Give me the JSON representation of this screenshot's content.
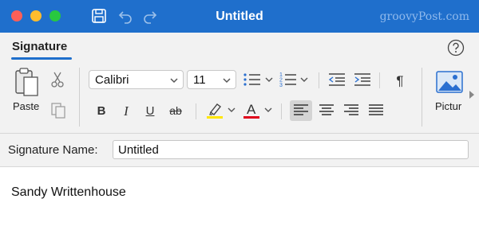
{
  "window": {
    "title": "Untitled",
    "watermark": "groovyPost.com"
  },
  "tabs": [
    {
      "label": "Signature",
      "active": true
    }
  ],
  "ribbon": {
    "paste_label": "Paste",
    "font": {
      "name": "Calibri",
      "size": "11"
    },
    "bold_label": "B",
    "italic_label": "I",
    "underline_label": "U",
    "strike_label": "ab",
    "paragraph_mark": "¶",
    "picture_label": "Pictur"
  },
  "signature_name": {
    "label": "Signature Name:",
    "value": "Untitled"
  },
  "editor": {
    "text": "Sandy Writtenhouse"
  },
  "colors": {
    "titlebar": "#1f6fcc",
    "accent": "#1f6fcc",
    "highlight": "#ffe600",
    "font_color": "#e0001b"
  }
}
